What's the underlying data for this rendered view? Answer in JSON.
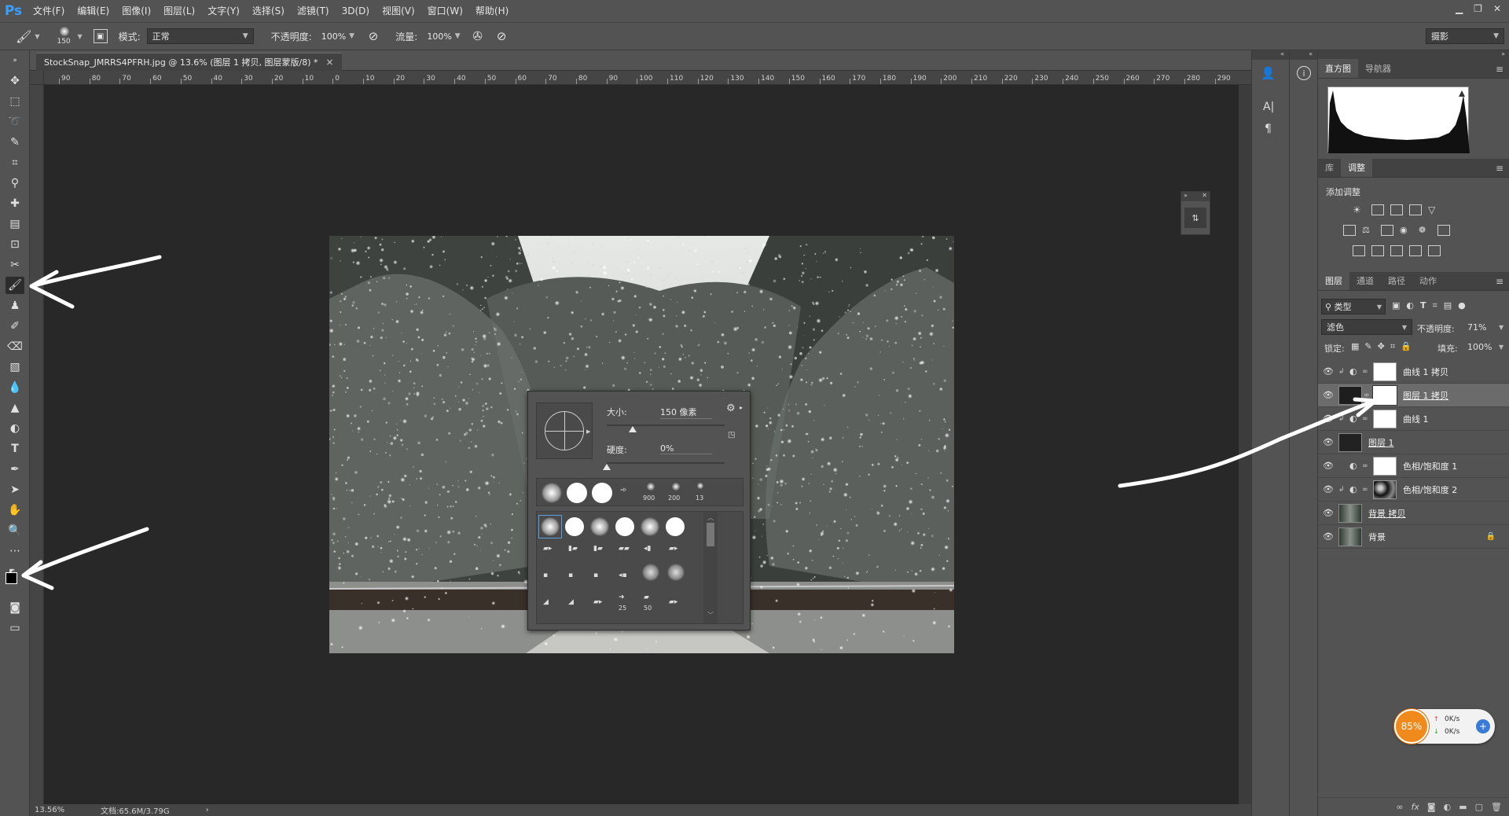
{
  "menubar": {
    "logo": "Ps",
    "items": [
      "文件(F)",
      "编辑(E)",
      "图像(I)",
      "图层(L)",
      "文字(Y)",
      "选择(S)",
      "滤镜(T)",
      "3D(D)",
      "视图(V)",
      "窗口(W)",
      "帮助(H)"
    ]
  },
  "options": {
    "brush_size": "150",
    "mode_label": "模式:",
    "mode_value": "正常",
    "opacity_label": "不透明度:",
    "opacity_value": "100%",
    "flow_label": "流量:",
    "flow_value": "100%",
    "workspace": "摄影"
  },
  "document": {
    "tab_title": "StockSnap_JMRRS4PFRH.jpg @ 13.6% (图层 1 拷贝, 图层蒙版/8) *",
    "close": "×"
  },
  "hruler": {
    "ticks": [
      "90",
      "80",
      "70",
      "60",
      "50",
      "40",
      "30",
      "20",
      "10",
      "0",
      "10",
      "20",
      "30",
      "40",
      "50",
      "60",
      "70",
      "80",
      "90",
      "100",
      "110",
      "120",
      "130",
      "140",
      "150",
      "160",
      "170",
      "180",
      "190",
      "200",
      "210",
      "220",
      "230",
      "240",
      "250",
      "260",
      "270",
      "280",
      "290"
    ]
  },
  "status": {
    "zoom": "13.56%",
    "doc": "文档:65.6M/3.79G",
    "arrow": "›"
  },
  "brush_popup": {
    "size_label": "大小:",
    "size_value": "150 像素",
    "hardness_label": "硬度:",
    "hardness_value": "0%",
    "size_slider_fraction": 0.22,
    "hardness_slider_fraction": 0.0,
    "preset_nums": [
      "900",
      "200",
      "13"
    ],
    "row3_nums": [
      "25",
      "50"
    ]
  },
  "histogram_panel": {
    "tabs": [
      "直方图",
      "导航器"
    ]
  },
  "adjust_panel": {
    "tabs": [
      "库",
      "调整"
    ],
    "title": "添加调整"
  },
  "layers_panel": {
    "tabs": [
      "图层",
      "通道",
      "路径",
      "动作"
    ],
    "filter": "类型",
    "blend": "滤色",
    "opacity_label": "不透明度:",
    "opacity_value": "71%",
    "lock_label": "锁定:",
    "fill_label": "填充:",
    "fill_value": "100%",
    "layers": [
      {
        "name": "曲线 1 拷贝",
        "thumb": "white"
      },
      {
        "name": "图层 1 拷贝",
        "thumb": "dark",
        "mask": true,
        "selected": true
      },
      {
        "name": "曲线 1",
        "thumb": "white"
      },
      {
        "name": "图层 1",
        "thumb": "dark"
      },
      {
        "name": "色相/饱和度 1",
        "thumb": "white"
      },
      {
        "name": "色相/饱和度 2",
        "thumb": "forest"
      },
      {
        "name": "背景 拷贝",
        "thumb": "forest"
      },
      {
        "name": "背景",
        "thumb": "forest",
        "locked": true
      }
    ]
  },
  "net_widget": {
    "percent": "85%",
    "up": "0K/s",
    "down": "0K/s"
  },
  "colors": {
    "ui_bg": "#535353",
    "canvas_bg": "#282828",
    "accent": "#3aa0ff",
    "widget_orange": "#f08a1c"
  }
}
